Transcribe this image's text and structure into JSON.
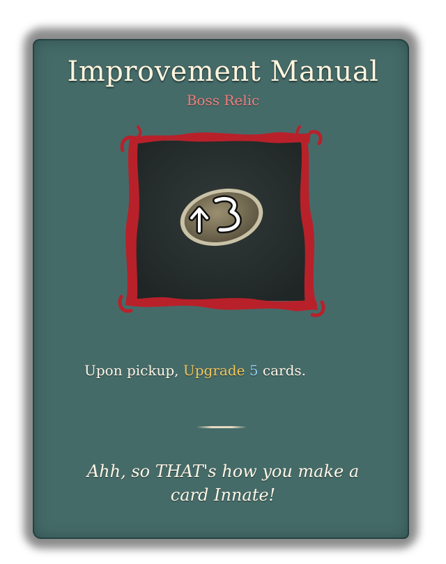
{
  "relic": {
    "name": "Improvement Manual",
    "tier": "Boss Relic",
    "icon": "upgrade-3-stone-icon",
    "icon_glyph": "↑3",
    "description": {
      "prefix": "Upon pickup, ",
      "keyword": "Upgrade",
      "space": " ",
      "amount": "5",
      "suffix": " cards."
    },
    "flavor_line1": "Ahh, so THAT's how you make a",
    "flavor_line2": "card Innate!"
  },
  "colors": {
    "card_background": "#456b69",
    "title": "#fff6df",
    "tier": "#ef7f7c",
    "keyword": "#f4c75a",
    "number": "#8fcdf0",
    "frame": "#b8212a"
  }
}
